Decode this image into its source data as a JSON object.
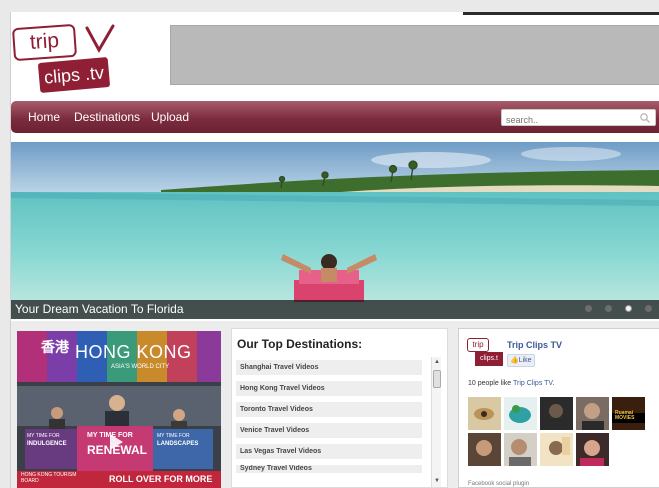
{
  "logo": {
    "line1": "trip",
    "line2": "clips .tv"
  },
  "nav": {
    "items": [
      {
        "label": "Home"
      },
      {
        "label": "Destinations"
      },
      {
        "label": "Upload"
      }
    ],
    "search_placeholder": "search.."
  },
  "hero": {
    "caption": "Your Dream Vacation To Florida",
    "slide_count": 4,
    "active_slide": 3
  },
  "ad": {
    "title": "HONG KONG",
    "subtitle": "ASIA'S WORLD CITY",
    "chinese": "香港",
    "cta": "ROLL OVER FOR MORE",
    "board": "HONG KONG TOURISM BOARD",
    "panel_left": "INDULGENCE",
    "panel_mid": "RENEWAL",
    "panel_right": "LANDSCAPES",
    "panel_mid_top": "MY TIME FOR",
    "panel_left_top": "MY TIME FOR",
    "panel_right_top": "MY TIME FOR"
  },
  "destinations": {
    "title": "Our Top Destinations:",
    "items": [
      "Shanghai Travel Videos",
      "Hong Kong Travel Videos",
      "Toronto Travel Videos",
      "Venice Travel Videos",
      "Las Vegas Travel Videos",
      "Sydney Travel Videos"
    ]
  },
  "facebook": {
    "page_name": "Trip Clips TV",
    "like_label": "Like",
    "count_text": "10 people like ",
    "count_link": "Trip Clips TV",
    "count_end": ".",
    "plugin_text": "Facebook social plugin",
    "faces_label": "Ruamai MOVIES"
  },
  "colors": {
    "brand": "#8e1f34",
    "facebook_blue": "#3b5998"
  }
}
